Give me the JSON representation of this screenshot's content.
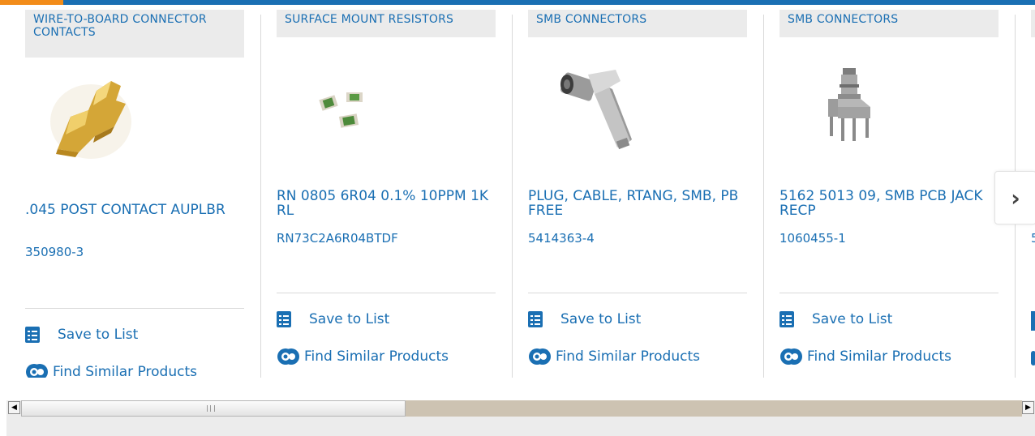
{
  "colors": {
    "accent": "#1a6fb3",
    "highlight": "#f28c1a"
  },
  "cards": [
    {
      "category": "WIRE-TO-BOARD CONNECTOR CONTACTS",
      "title": ".045 POST CONTACT AUPLBR",
      "part_number": "350980-3",
      "save_label": "Save to List",
      "similar_label": "Find Similar Products"
    },
    {
      "category": "SURFACE MOUNT RESISTORS",
      "title": "RN 0805 6R04 0.1% 10PPM 1K RL",
      "part_number": "RN73C2A6R04BTDF",
      "save_label": "Save to List",
      "similar_label": "Find Similar Products"
    },
    {
      "category": "SMB CONNECTORS",
      "title": "PLUG, CABLE, RTANG, SMB, PB FREE",
      "part_number": "5414363-4",
      "save_label": "Save to List",
      "similar_label": "Find Similar Products"
    },
    {
      "category": "SMB CONNECTORS",
      "title": "5162 5013 09, SMB PCB JACK RECP",
      "part_number": "1060455-1",
      "save_label": "Save to List",
      "similar_label": "Find Similar Products"
    }
  ],
  "partial_card": {
    "part_number_fragment": "5"
  },
  "carousel": {
    "next_glyph": "›"
  },
  "scrollbar": {
    "left_arrow": "◀",
    "right_arrow": "▶"
  }
}
